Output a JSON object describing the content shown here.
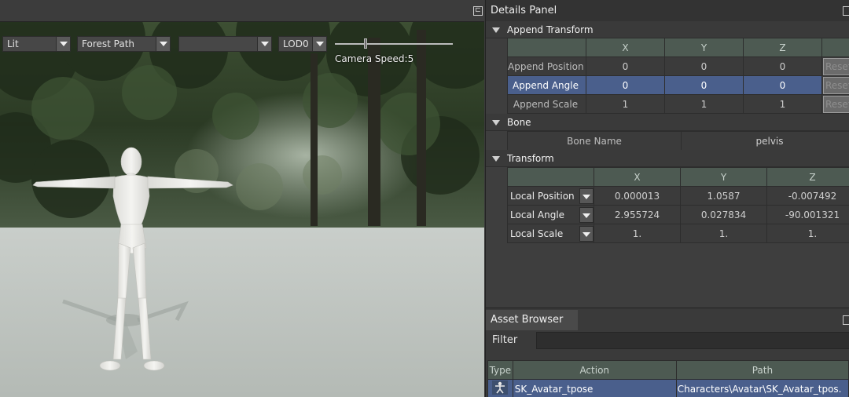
{
  "viewport": {
    "lighting_mode": "Lit",
    "environment": "Forest Path",
    "third_dropdown": "",
    "lod": "LOD0",
    "camera_speed_label": "Camera Speed:5",
    "camera_speed_level": 0.25
  },
  "details_panel": {
    "title": "Details Panel",
    "append_transform": {
      "title": "Append Transform",
      "columns": [
        "X",
        "Y",
        "Z"
      ],
      "reset_label": "Reset",
      "rows": [
        {
          "label": "Append Position",
          "x": "0",
          "y": "0",
          "z": "0",
          "selected": false
        },
        {
          "label": "Append Angle",
          "x": "0",
          "y": "0",
          "z": "0",
          "selected": true
        },
        {
          "label": "Append Scale",
          "x": "1",
          "y": "1",
          "z": "1",
          "selected": false
        }
      ]
    },
    "bone": {
      "title": "Bone",
      "name_label": "Bone Name",
      "name_value": "pelvis"
    },
    "transform": {
      "title": "Transform",
      "columns": [
        "X",
        "Y",
        "Z"
      ],
      "rows": [
        {
          "label": "Local Position",
          "x": "0.000013",
          "y": "1.0587",
          "z": "-0.007492"
        },
        {
          "label": "Local Angle",
          "x": "2.955724",
          "y": "0.027834",
          "z": "-90.001321"
        },
        {
          "label": "Local Scale",
          "x": "1.",
          "y": "1.",
          "z": "1."
        }
      ]
    }
  },
  "asset_browser": {
    "title": "Asset Browser",
    "filter_label": "Filter",
    "filter_value": "",
    "columns": [
      "Type",
      "Action",
      "Path"
    ],
    "rows": [
      {
        "type_icon": "skeleton-icon",
        "action": "SK_Avatar_tpose",
        "path": "Characters\\Avatar\\SK_Avatar_tpos."
      }
    ]
  },
  "colors": {
    "selection": "#4a5f8c",
    "header": "#4d5a52"
  }
}
